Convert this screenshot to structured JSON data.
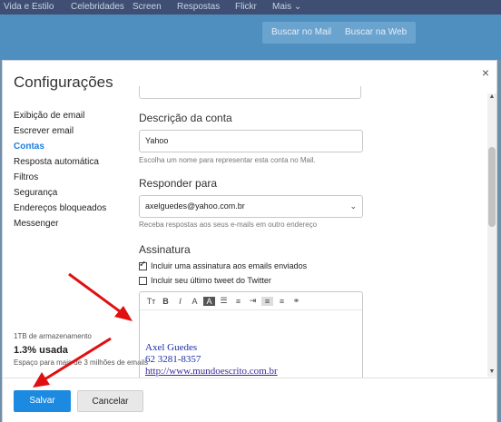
{
  "topnav": {
    "items": [
      "Vida e Estilo",
      "Celebridades",
      "Screen",
      "Respostas",
      "Flickr",
      "Mais ⌄"
    ]
  },
  "searchbar": {
    "mail_btn": "Buscar no Mail",
    "web_btn": "Buscar na Web"
  },
  "dialog": {
    "title": "Configurações",
    "close": "×",
    "sidebar": [
      "Exibição de email",
      "Escrever email",
      "Contas",
      "Resposta automática",
      "Filtros",
      "Segurança",
      "Endereços bloqueados",
      "Messenger"
    ],
    "active_item": "Contas",
    "storage": {
      "capacity": "1TB de armazenamento",
      "used": "1.3% usada",
      "note": "Espaço para mais de 3 milhões de emails"
    },
    "account": {
      "description_label": "Descrição da conta",
      "description_value": "Yahoo",
      "description_hint": "Escolha um nome para representar esta conta no Mail.",
      "reply_label": "Responder para",
      "reply_value": "axelguedes@yahoo.com.br",
      "reply_hint": "Receba respostas aos seus e-mails em outro endereço",
      "signature_label": "Assinatura",
      "include_signature": "Incluir uma assinatura aos emails enviados",
      "include_signature_checked": true,
      "include_tweet": "Incluir seu último tweet do Twitter",
      "include_tweet_checked": false
    },
    "signature": {
      "name": "Axel Guedes",
      "phone": "62 3281-8357",
      "url": "http://www.mundoescrito.com.br"
    },
    "buttons": {
      "save": "Salvar",
      "cancel": "Cancelar"
    }
  },
  "colors": {
    "accent": "#1b8ae0",
    "arrow": "#e01010",
    "signature_text": "#1b2ea3"
  }
}
